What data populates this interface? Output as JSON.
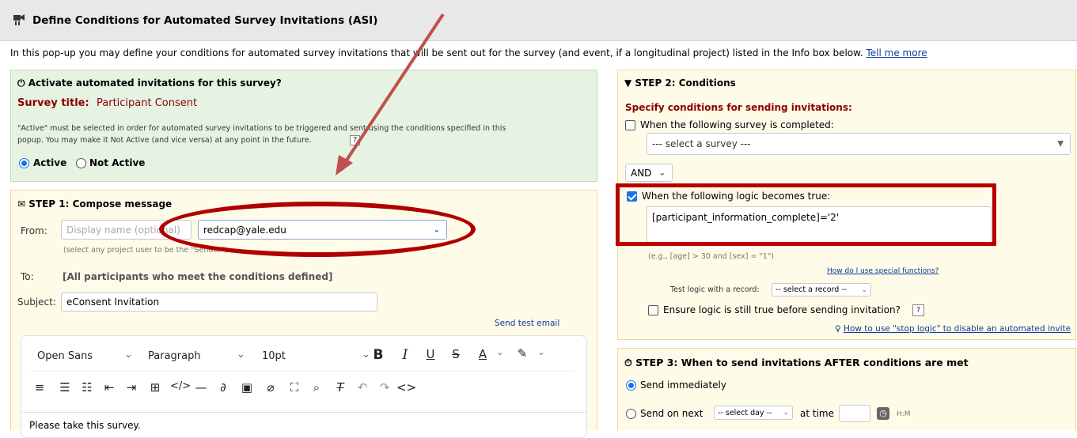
{
  "header": {
    "title": "Define Conditions for Automated Survey Invitations (ASI)",
    "icon": "survey-invite-icon"
  },
  "intro": {
    "text": "In this pop-up you may define your conditions for automated survey invitations that will be sent out for the survey (and event, if a longitudinal project) listed in the Info box below.",
    "link": "Tell me more"
  },
  "activate": {
    "heading": "Activate automated invitations for this survey?",
    "survey_title_label": "Survey title:",
    "survey_title_value": "Participant Consent",
    "note_line1": "\"Active\" must be selected in order for automated survey invitations to be triggered and sent using the conditions specified in this",
    "note_line2": "popup. You may make it Not Active (and vice versa) at any point in the future.",
    "active_label": "Active",
    "not_active_label": "Not Active",
    "selected": "Active"
  },
  "step1": {
    "heading": "STEP 1: Compose message",
    "from_label": "From:",
    "display_name_placeholder": "Display name (optional)",
    "from_email": "redcap@yale.edu",
    "from_hint": "(select any project user to be the \"Sender\")",
    "to_label": "To:",
    "to_value": "[All participants who meet the conditions defined]",
    "subject_label": "Subject:",
    "subject_value": "eConsent Invitation",
    "send_test": "Send test email",
    "editor": {
      "font": "Open Sans",
      "block": "Paragraph",
      "size": "10pt",
      "body": "Please take this survey."
    }
  },
  "step2": {
    "heading": "STEP 2: Conditions",
    "subheading": "Specify conditions for sending invitations:",
    "survey_completed_label": "When the following survey is completed:",
    "survey_completed_checked": false,
    "survey_select_value": "--- select a survey ---",
    "and_or_value": "AND",
    "logic_label": "When the following logic becomes true:",
    "logic_checked": true,
    "logic_value": "[participant_information_complete]='2'",
    "logic_example": "(e.g., [age] > 30 and [sex] = \"1\")",
    "special_functions_link": "How do I use special functions?",
    "test_logic_label": "Test logic with a record:",
    "test_logic_select": "-- select a record --",
    "ensure_label": "Ensure logic is still true before sending invitation?",
    "ensure_checked": false,
    "stop_logic_link": "How to use \"stop logic\" to disable an automated invite"
  },
  "step3": {
    "heading": "STEP 3: When to send invitations AFTER conditions are met",
    "send_immediately": "Send immediately",
    "send_on_next": "Send on next",
    "select_day": "-- select day --",
    "at_time": "at time",
    "time_format": "H:M",
    "selected": "Send immediately"
  },
  "annotations": {
    "color": "#b00000"
  }
}
